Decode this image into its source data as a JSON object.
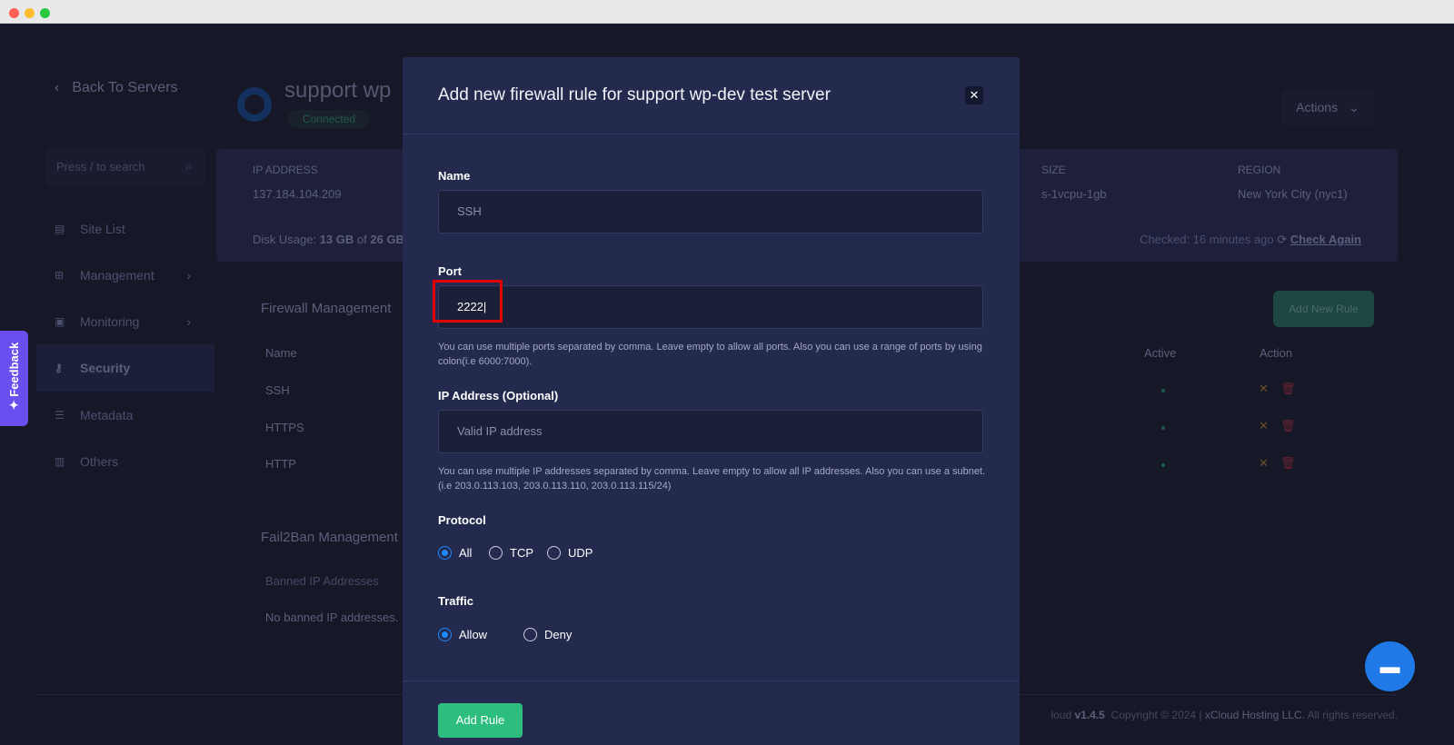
{
  "sidebar": {
    "back": "Back To Servers",
    "search_placeholder": "Press / to search",
    "items": [
      {
        "label": "Site List",
        "icon": "list-icon"
      },
      {
        "label": "Management",
        "icon": "sitemap-icon"
      },
      {
        "label": "Monitoring",
        "icon": "monitor-icon"
      },
      {
        "label": "Security",
        "icon": "key-icon",
        "active": true
      },
      {
        "label": "Metadata",
        "icon": "metadata-icon"
      },
      {
        "label": "Others",
        "icon": "server-icon"
      }
    ]
  },
  "header": {
    "server_name": "support wp",
    "status": "Connected",
    "actions": "Actions"
  },
  "stats": {
    "ip_label": "IP ADDRESS",
    "ip": "137.184.104.209",
    "size_label": "SIZE",
    "size": "s-1vcpu-1gb",
    "region_label": "REGION",
    "region": "New York City (nyc1)",
    "disk_prefix": "Disk Usage:",
    "disk_used": "13 GB",
    "disk_of": "of",
    "disk_total": "26 GB",
    "checked": "Checked: 16 minutes ago",
    "check_again": "Check Again"
  },
  "firewall": {
    "title": "Firewall Management",
    "add_button": "Add New Rule",
    "columns": [
      "Name",
      "Active",
      "Action"
    ],
    "rows": [
      "SSH",
      "HTTPS",
      "HTTP"
    ]
  },
  "fail2ban": {
    "title": "Fail2Ban Management",
    "column": "Banned IP Addresses",
    "empty": "No banned IP addresses."
  },
  "footer": {
    "brand_partial": "loud",
    "version": "v1.4.5",
    "copyright": "Copyright © 2024 |",
    "company": "xCloud Hosting LLC.",
    "rights": "All rights reserved."
  },
  "feedback": "Feedback",
  "modal": {
    "title": "Add new firewall rule for support wp-dev test server",
    "name_label": "Name",
    "name_placeholder": "SSH",
    "port_label": "Port",
    "port_value": "2222",
    "port_help": "You can use multiple ports separated by comma. Leave empty to allow all ports. Also you can use a range of ports by using colon(i.e 6000:7000).",
    "ip_label": "IP Address (Optional)",
    "ip_placeholder": "Valid IP address",
    "ip_help": "You can use multiple IP addresses separated by comma. Leave empty to allow all IP addresses. Also you can use a subnet. (i.e 203.0.113.103, 203.0.113.110, 203.0.113.115/24)",
    "protocol_label": "Protocol",
    "protocols": [
      "All",
      "TCP",
      "UDP"
    ],
    "protocol_selected": "All",
    "traffic_label": "Traffic",
    "traffic_options": [
      "Allow",
      "Deny"
    ],
    "traffic_selected": "Allow",
    "submit": "Add Rule"
  },
  "colors": {
    "accent": "#1e88ff",
    "submit": "#2dbd7e",
    "highlight": "#e00000",
    "feedback": "#6b4ef0"
  }
}
